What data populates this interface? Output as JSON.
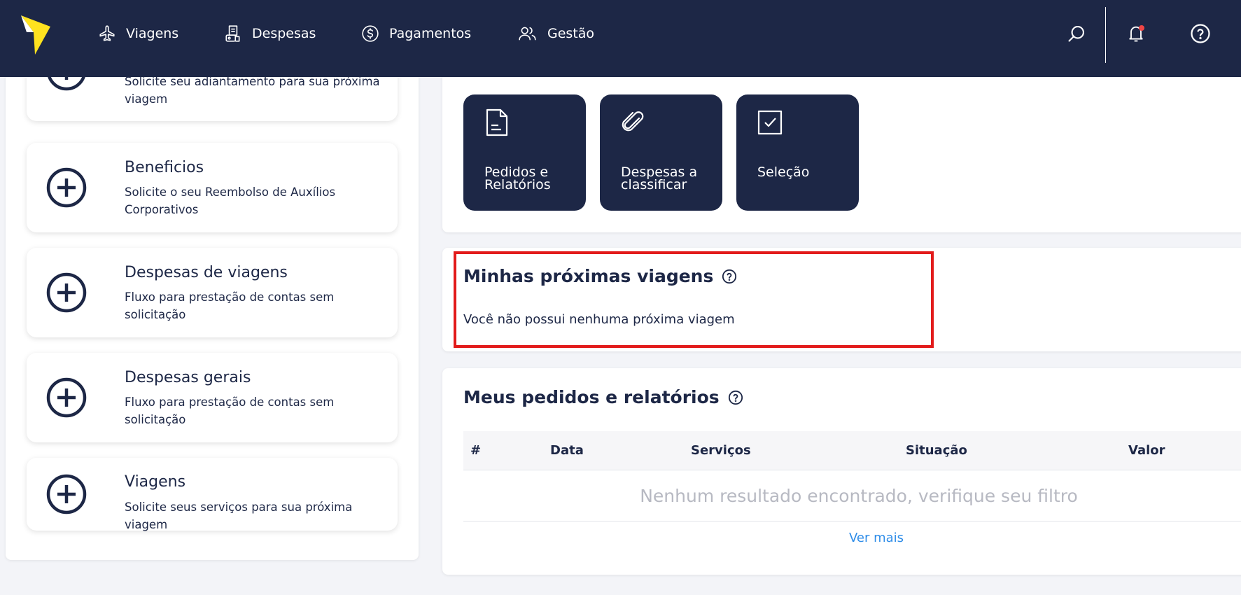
{
  "nav": {
    "items": [
      {
        "label": "Viagens",
        "icon": "airplane-icon"
      },
      {
        "label": "Despesas",
        "icon": "receipt-icon"
      },
      {
        "label": "Pagamentos",
        "icon": "dollar-circle-icon"
      },
      {
        "label": "Gestão",
        "icon": "users-icon"
      }
    ],
    "actions": [
      "search-icon",
      "bell-icon",
      "help-icon"
    ],
    "has_notification": true
  },
  "left_cards": [
    {
      "title": "",
      "desc": "Solicite seu adiantamento para sua próxima viagem"
    },
    {
      "title": "Beneficios",
      "desc": "Solicite o seu Reembolso de Auxílios Corporativos"
    },
    {
      "title": "Despesas de viagens",
      "desc": "Fluxo para prestação de contas sem solicitação"
    },
    {
      "title": "Despesas gerais",
      "desc": "Fluxo para prestação de contas sem solicitação"
    },
    {
      "title": "Viagens",
      "desc": "Solicite seus serviços para sua próxima viagem"
    }
  ],
  "tiles": [
    {
      "label": "Pedidos e Relatórios",
      "icon": "document-icon"
    },
    {
      "label": "Despesas a classificar",
      "icon": "paperclip-icon"
    },
    {
      "label": "Seleção",
      "icon": "checkbox-icon"
    }
  ],
  "trips": {
    "title": "Minhas próximas viagens",
    "empty": "Você não possui nenhuma próxima viagem"
  },
  "orders": {
    "title": "Meus pedidos e relatórios",
    "columns": [
      "#",
      "Data",
      "Serviços",
      "Situação",
      "Valor"
    ],
    "empty": "Nenhum resultado encontrado, verifique seu filtro",
    "see_more": "Ver mais"
  },
  "colors": {
    "navy": "#1d2746",
    "accent_yellow": "#ffe21f",
    "highlight_red": "#e21b1b",
    "link_blue": "#2d8ce8"
  }
}
